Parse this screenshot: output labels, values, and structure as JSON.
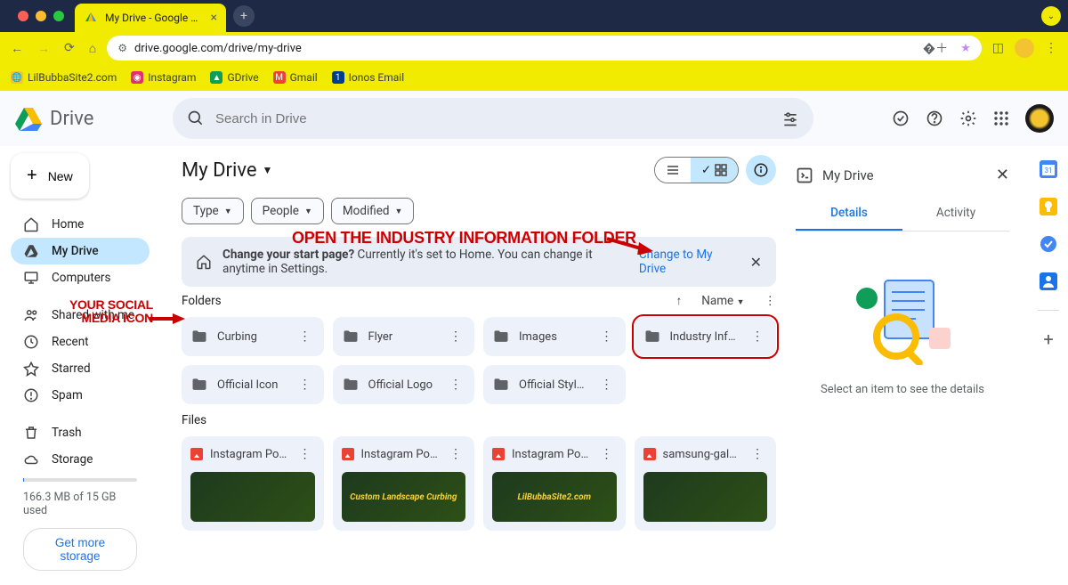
{
  "browser": {
    "tab_title": "My Drive - Google Drive",
    "url": "drive.google.com/drive/my-drive",
    "bookmarks": [
      {
        "label": "LilBubbaSite2.com",
        "icon": "🌐",
        "color": "#f4c430"
      },
      {
        "label": "Instagram",
        "icon": "◉",
        "color": "#e1306c"
      },
      {
        "label": "GDrive",
        "icon": "▲",
        "color": "#0f9d58"
      },
      {
        "label": "Gmail",
        "icon": "M",
        "color": "#ea4335"
      },
      {
        "label": "Ionos Email",
        "icon": "1",
        "color": "#003d8f"
      }
    ]
  },
  "drive": {
    "app_name": "Drive",
    "search_placeholder": "Search in Drive",
    "new_button": "New",
    "nav": [
      {
        "label": "Home",
        "icon": "home"
      },
      {
        "label": "My Drive",
        "icon": "drive",
        "active": true
      },
      {
        "label": "Computers",
        "icon": "computer"
      },
      {
        "label": "Shared with me",
        "icon": "people"
      },
      {
        "label": "Recent",
        "icon": "clock"
      },
      {
        "label": "Starred",
        "icon": "star"
      },
      {
        "label": "Spam",
        "icon": "spam"
      },
      {
        "label": "Trash",
        "icon": "trash"
      },
      {
        "label": "Storage",
        "icon": "cloud"
      }
    ],
    "storage_text": "166.3 MB of 15 GB used",
    "get_storage": "Get more storage"
  },
  "main": {
    "breadcrumb": "My Drive",
    "chips": [
      "Type",
      "People",
      "Modified"
    ],
    "banner": {
      "text_bold": "Change your start page?",
      "text_rest": "Currently it's set to Home. You can change it anytime in Settings.",
      "link": "Change to My Drive"
    },
    "folders_label": "Folders",
    "sort_label": "Name",
    "folders": [
      {
        "name": "Curbing"
      },
      {
        "name": "Flyer"
      },
      {
        "name": "Images"
      },
      {
        "name": "Industry Inform…",
        "highlight": true
      },
      {
        "name": "Official Icon"
      },
      {
        "name": "Official Logo"
      },
      {
        "name": "Official Style Gu…"
      }
    ],
    "files_label": "Files",
    "files": [
      {
        "name": "Instagram Post …",
        "thumb_text": ""
      },
      {
        "name": "Instagram Post …",
        "thumb_text": "Custom Landscape Curbing"
      },
      {
        "name": "Instagram Post …",
        "thumb_text": "LilBubbaSite2.com"
      },
      {
        "name": "samsung-galax…",
        "thumb_text": ""
      }
    ]
  },
  "details": {
    "title": "My Drive",
    "tab_details": "Details",
    "tab_activity": "Activity",
    "msg": "Select an item to see the details"
  },
  "annotations": {
    "a1": "OPEN THE INDUSTRY INFORMATION FOLDER",
    "a2_l1": "YOUR SOCIAL",
    "a2_l2": "MEDIA ICON"
  }
}
